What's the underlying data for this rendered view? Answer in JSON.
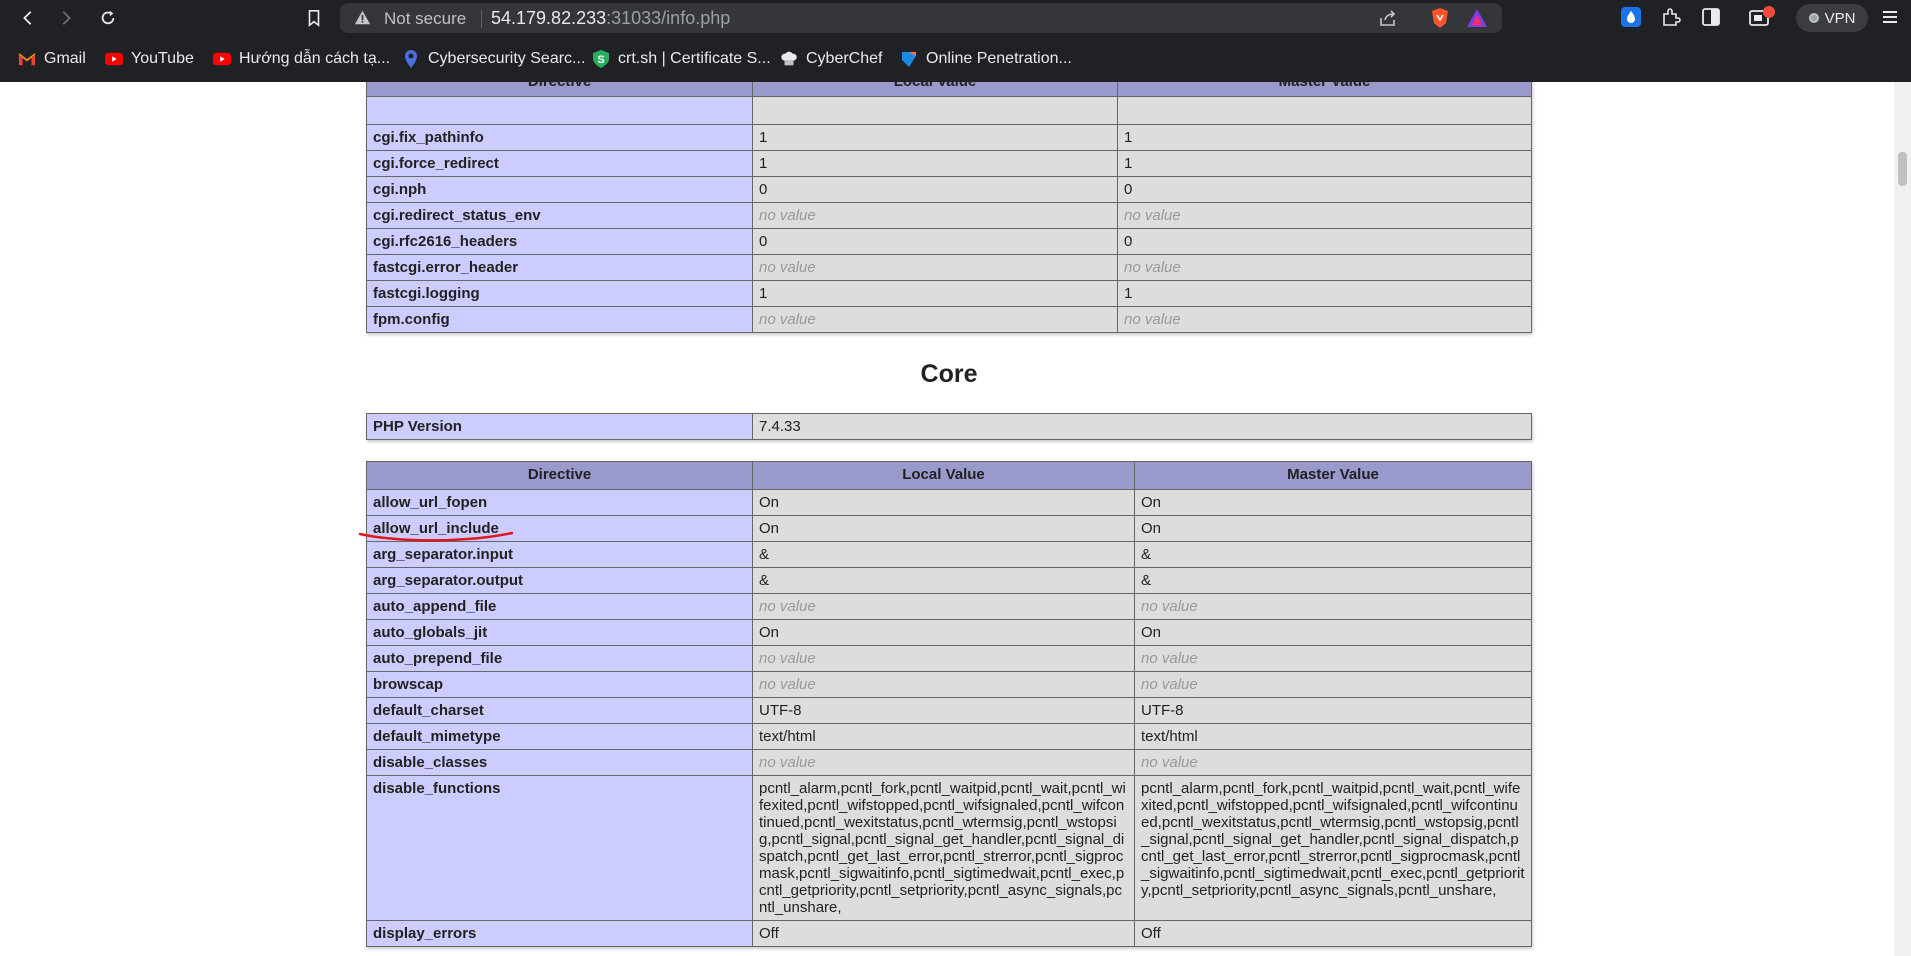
{
  "browser": {
    "security_label": "Not secure",
    "url_host": "54.179.82.233",
    "url_rest": ":31033/info.php",
    "vpn_label": "VPN",
    "bookmarks": [
      {
        "label": "Gmail",
        "icon": "gmail-icon"
      },
      {
        "label": "YouTube",
        "icon": "youtube-icon"
      },
      {
        "label": "Hướng dẫn cách tạ...",
        "icon": "youtube-icon"
      },
      {
        "label": "Cybersecurity Searc...",
        "icon": "location-pin-icon"
      },
      {
        "label": "crt.sh | Certificate S...",
        "icon": "crtsh-icon"
      },
      {
        "label": "CyberChef",
        "icon": "chef-hat-icon"
      },
      {
        "label": "Online Penetration...",
        "icon": "shield-icon"
      }
    ]
  },
  "top_table": {
    "headers": [
      "Directive",
      "Local Value",
      "Master Value"
    ],
    "rows": [
      {
        "directive": "cgi.fix_pathinfo",
        "local": "1",
        "master": "1"
      },
      {
        "directive": "cgi.force_redirect",
        "local": "1",
        "master": "1"
      },
      {
        "directive": "cgi.nph",
        "local": "0",
        "master": "0"
      },
      {
        "directive": "cgi.redirect_status_env",
        "local": "no value",
        "master": "no value"
      },
      {
        "directive": "cgi.rfc2616_headers",
        "local": "0",
        "master": "0"
      },
      {
        "directive": "fastcgi.error_header",
        "local": "no value",
        "master": "no value"
      },
      {
        "directive": "fastcgi.logging",
        "local": "1",
        "master": "1"
      },
      {
        "directive": "fpm.config",
        "local": "no value",
        "master": "no value"
      }
    ]
  },
  "core": {
    "title": "Core",
    "php_version_label": "PHP Version",
    "php_version": "7.4.33"
  },
  "core_table": {
    "headers": [
      "Directive",
      "Local Value",
      "Master Value"
    ],
    "rows": [
      {
        "directive": "allow_url_fopen",
        "local": "On",
        "master": "On"
      },
      {
        "directive": "allow_url_include",
        "local": "On",
        "master": "On"
      },
      {
        "directive": "arg_separator.input",
        "local": "&",
        "master": "&"
      },
      {
        "directive": "arg_separator.output",
        "local": "&",
        "master": "&"
      },
      {
        "directive": "auto_append_file",
        "local": "no value",
        "master": "no value"
      },
      {
        "directive": "auto_globals_jit",
        "local": "On",
        "master": "On"
      },
      {
        "directive": "auto_prepend_file",
        "local": "no value",
        "master": "no value"
      },
      {
        "directive": "browscap",
        "local": "no value",
        "master": "no value"
      },
      {
        "directive": "default_charset",
        "local": "UTF-8",
        "master": "UTF-8"
      },
      {
        "directive": "default_mimetype",
        "local": "text/html",
        "master": "text/html"
      },
      {
        "directive": "disable_classes",
        "local": "no value",
        "master": "no value"
      },
      {
        "directive": "disable_functions",
        "local": "pcntl_alarm,pcntl_fork,pcntl_waitpid,pcntl_wait,pcntl_wifexited,pcntl_wifstopped,pcntl_wifsignaled,pcntl_wifcontinued,pcntl_wexitstatus,pcntl_wtermsig,pcntl_wstopsig,pcntl_signal,pcntl_signal_get_handler,pcntl_signal_dispatch,pcntl_get_last_error,pcntl_strerror,pcntl_sigprocmask,pcntl_sigwaitinfo,pcntl_sigtimedwait,pcntl_exec,pcntl_getpriority,pcntl_setpriority,pcntl_async_signals,pcntl_unshare,",
        "master": "pcntl_alarm,pcntl_fork,pcntl_waitpid,pcntl_wait,pcntl_wifexited,pcntl_wifstopped,pcntl_wifsignaled,pcntl_wifcontinued,pcntl_wexitstatus,pcntl_wtermsig,pcntl_wstopsig,pcntl_signal,pcntl_signal_get_handler,pcntl_signal_dispatch,pcntl_get_last_error,pcntl_strerror,pcntl_sigprocmask,pcntl_sigwaitinfo,pcntl_sigtimedwait,pcntl_exec,pcntl_getpriority,pcntl_setpriority,pcntl_async_signals,pcntl_unshare,"
      },
      {
        "directive": "display_errors",
        "local": "Off",
        "master": "Off"
      }
    ]
  },
  "colors": {
    "header_bg": "#9999cc",
    "directive_bg": "#ccccff",
    "value_bg": "#dddddd",
    "annotation": "#e0161b"
  }
}
